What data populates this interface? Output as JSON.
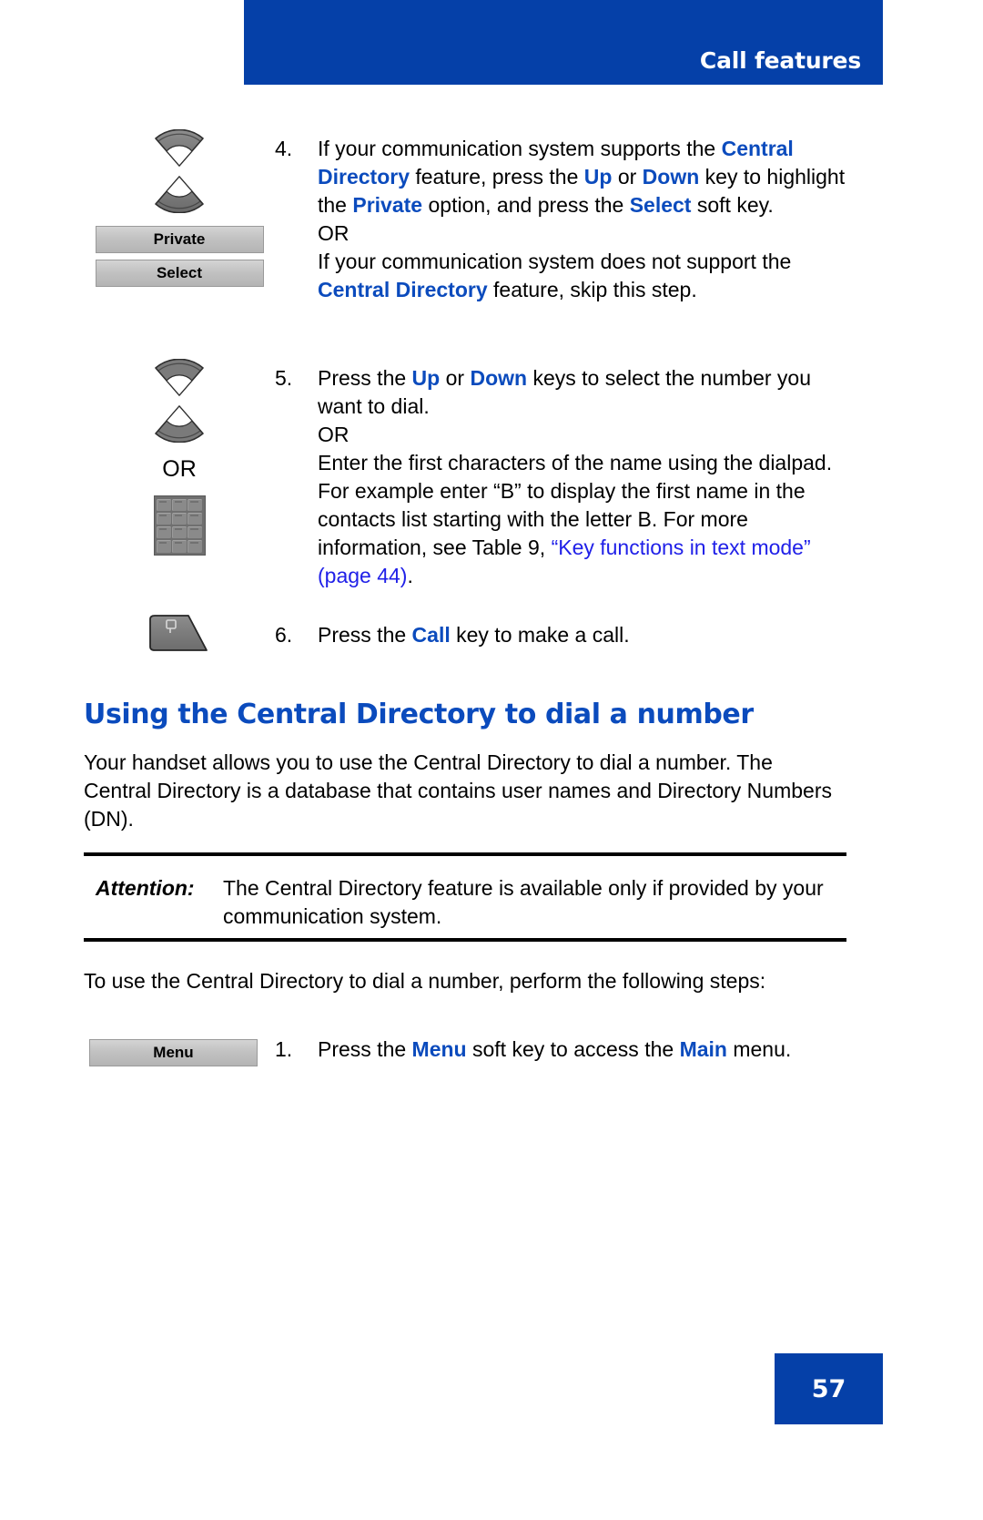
{
  "header": {
    "title": "Call features",
    "bar_color": "#0540a8"
  },
  "steps": [
    {
      "number": "4.",
      "icons": [
        "up-key",
        "down-key"
      ],
      "softkeys": [
        "Private",
        "Select"
      ],
      "lines": [
        "If your communication system supports the ",
        "Central Directory",
        " feature, press the ",
        "Up",
        " or ",
        "Down",
        " key to highlight the ",
        "Private",
        " option, and press the ",
        "Select",
        " soft key."
      ],
      "or_text": "OR",
      "alt_lines": [
        "If your communication system does not support the ",
        "Central Directory",
        " feature, skip this step."
      ]
    },
    {
      "number": "5.",
      "icons": [
        "up-key",
        "down-key",
        "dialpad"
      ],
      "or_between_icons": "OR",
      "lines": [
        "Press the ",
        "Up",
        " or ",
        "Down",
        " keys to select the number you want to dial."
      ],
      "or_text": "OR",
      "alt_lines": [
        "Enter the first characters of the name using the dialpad. For example enter “B” to display the first name in the contacts list starting with the letter B. For more information, see Table 9, ",
        "“Key functions in text mode” (page 44)",
        "."
      ],
      "link_text": "“Key functions in text mode” (page 44)"
    },
    {
      "number": "6.",
      "icons": [
        "call-key"
      ],
      "lines": [
        "Press the ",
        "Call",
        " key to make a call."
      ]
    }
  ],
  "section": {
    "heading": "Using the Central Directory to dial a number",
    "intro": "Your handset allows you to use the Central Directory to dial a number. The Central Directory is a database that contains user names and Directory Numbers (DN)."
  },
  "attention": {
    "label": "Attention:",
    "text": "The Central Directory feature is available only if provided by your communication system."
  },
  "procedure_intro": "To use the Central Directory to dial a number, perform the following steps:",
  "final_step": {
    "number": "1.",
    "softkey": "Menu",
    "text_parts": {
      "p1": "Press the ",
      "menu": "Menu",
      "p2": " soft key to access the ",
      "main": "Main",
      "p3": " menu."
    }
  },
  "footer": {
    "page_number": "57"
  },
  "colors": {
    "brand_blue": "#0540a8",
    "bold_blue": "#0b4bbd",
    "link_blue": "#2020e8",
    "softkey_gray": "#c2c2c2"
  },
  "text": {
    "or": "OR",
    "step4_seg1": "If your communication system supports the ",
    "step4_central_directory": "Central Directory",
    "step4_seg2": " feature, press the ",
    "step4_up": "Up",
    "step4_or": " or ",
    "step4_down": "Down",
    "step4_seg3": " key to highlight the ",
    "step4_private": "Private",
    "step4_seg4": " option, and press the ",
    "step4_select": "Select",
    "step4_seg5": " soft key.",
    "step4_alt1": "If your communication system does not support the ",
    "step4_alt_cd": "Central Directory",
    "step4_alt2": " feature, skip this step.",
    "step5_seg1": "Press the ",
    "step5_up": "Up",
    "step5_or": " or ",
    "step5_down": "Down",
    "step5_seg2": " keys to select the number you want to dial.",
    "step5_alt1": "Enter the first characters of the name using the dialpad. For example enter “B” to display the first name in the contacts list starting with the letter B. For more information, see Table 9, ",
    "step5_link": "“Key functions in text mode” (page 44)",
    "step5_alt2": ".",
    "step6_seg1": "Press the ",
    "step6_call": "Call",
    "step6_seg2": " key to make a call."
  }
}
